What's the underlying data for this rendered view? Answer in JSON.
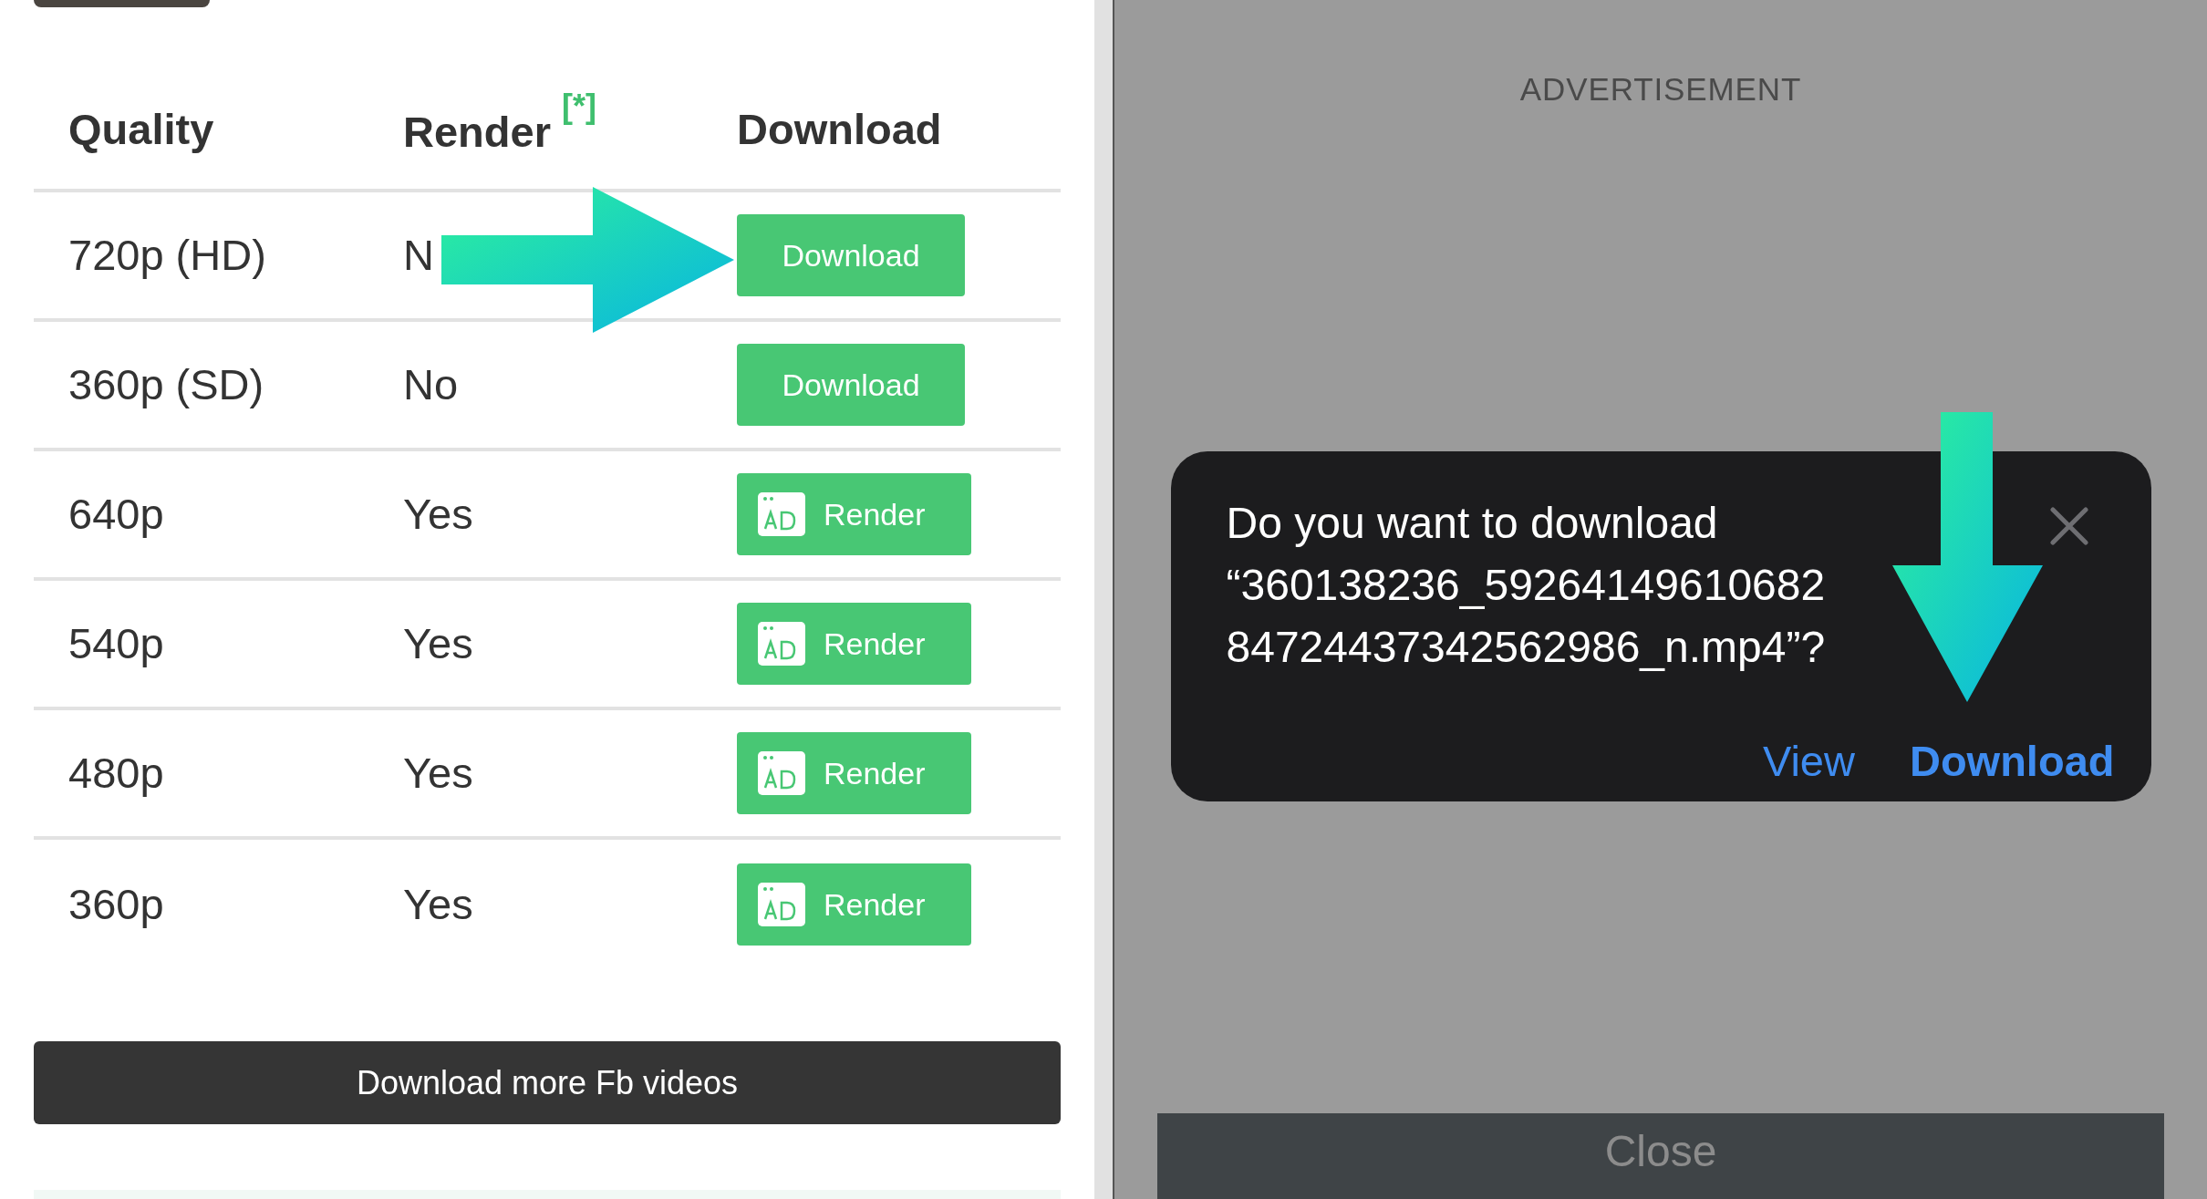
{
  "table": {
    "columns": [
      {
        "label": "Quality"
      },
      {
        "label": "Render",
        "note": "[*]"
      },
      {
        "label": "Download"
      }
    ],
    "rows": [
      {
        "quality": "720p (HD)",
        "render": "N",
        "button": {
          "kind": "download",
          "label": "Download"
        }
      },
      {
        "quality": "360p (SD)",
        "render": "No",
        "button": {
          "kind": "download",
          "label": "Download"
        }
      },
      {
        "quality": "640p",
        "render": "Yes",
        "button": {
          "kind": "render",
          "label": "Render"
        }
      },
      {
        "quality": "540p",
        "render": "Yes",
        "button": {
          "kind": "render",
          "label": "Render"
        }
      },
      {
        "quality": "480p",
        "render": "Yes",
        "button": {
          "kind": "render",
          "label": "Render"
        }
      },
      {
        "quality": "360p",
        "render": "Yes",
        "button": {
          "kind": "render",
          "label": "Render"
        }
      }
    ]
  },
  "more_button": "Download more Fb videos",
  "advertisement_label": "ADVERTISEMENT",
  "dialog": {
    "message_lines": [
      "Do you want to download",
      "“360138236_59264149610682",
      "84724437342562986_n.mp4”?"
    ],
    "actions": [
      {
        "label": "View",
        "primary": false
      },
      {
        "label": "Download",
        "primary": true
      }
    ]
  },
  "close_button": "Close"
}
